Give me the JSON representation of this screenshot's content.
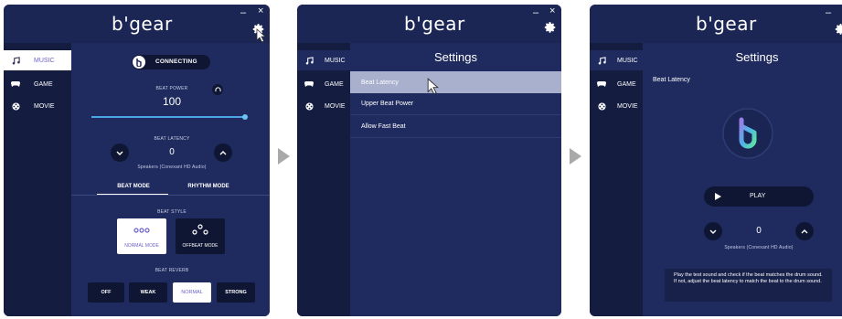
{
  "app": {
    "brand": "b'gear",
    "minimize": "–",
    "close": "×"
  },
  "nav": {
    "music": "MUSIC",
    "game": "GAME",
    "movie": "MOVIE"
  },
  "screen1": {
    "connection_status": "CONNECTING",
    "beat_power_label": "BEAT POWER",
    "beat_power_value": "100",
    "beat_power_level": 1.0,
    "beat_latency_label": "BEAT LATENCY",
    "beat_latency_value": "0",
    "device_name": "Speakers (Conexant HD Audio)",
    "tabs": [
      "BEAT MODE",
      "RHYTHM MODE"
    ],
    "beat_style_label": "BEAT STYLE",
    "beat_styles": [
      "NORMAL MODE",
      "OFFBEAT MODE"
    ],
    "beat_reverb_label": "BEAT REVERB",
    "reverb_options": [
      "OFF",
      "WEAK",
      "NORMAL",
      "STRONG"
    ]
  },
  "screen2": {
    "title": "Settings",
    "items": [
      "Beat Latency",
      "Upper Beat Power",
      "Allow Fast Beat"
    ]
  },
  "screen3": {
    "title": "Settings",
    "section": "Beat Latency",
    "play_label": "PLAY",
    "latency_value": "0",
    "device_name": "Speakers (Conexant HD Audio)",
    "help_text": "Play the test sound and check if the beat matches the drum sound. If not, adjust the beat latency to match the beat to the drum sound."
  },
  "colors": {
    "panel": "#1f2b5e",
    "sidebar": "#141c40",
    "accent": "#6b63c9",
    "slider": "#4aa6e6"
  }
}
